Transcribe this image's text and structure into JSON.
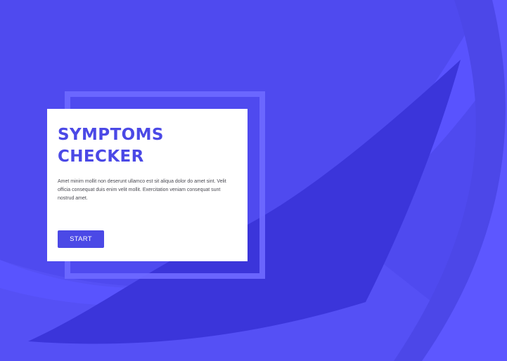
{
  "hero": {
    "title_line1": "SYMPTOMS",
    "title_line2": "CHECKER",
    "description": "Amet minim mollit non deserunt ullamco est sit aliqua dolor do amet sint. Velit officia consequat duis enim velit mollit. Exercitation veniam consequat sunt nostrud amet.",
    "start_label": "START"
  },
  "colors": {
    "background": "#4f4aef",
    "accent": "#4b49e6",
    "shape_light": "#5c55ff",
    "shape_dark": "#3934d9",
    "card": "#ffffff"
  }
}
